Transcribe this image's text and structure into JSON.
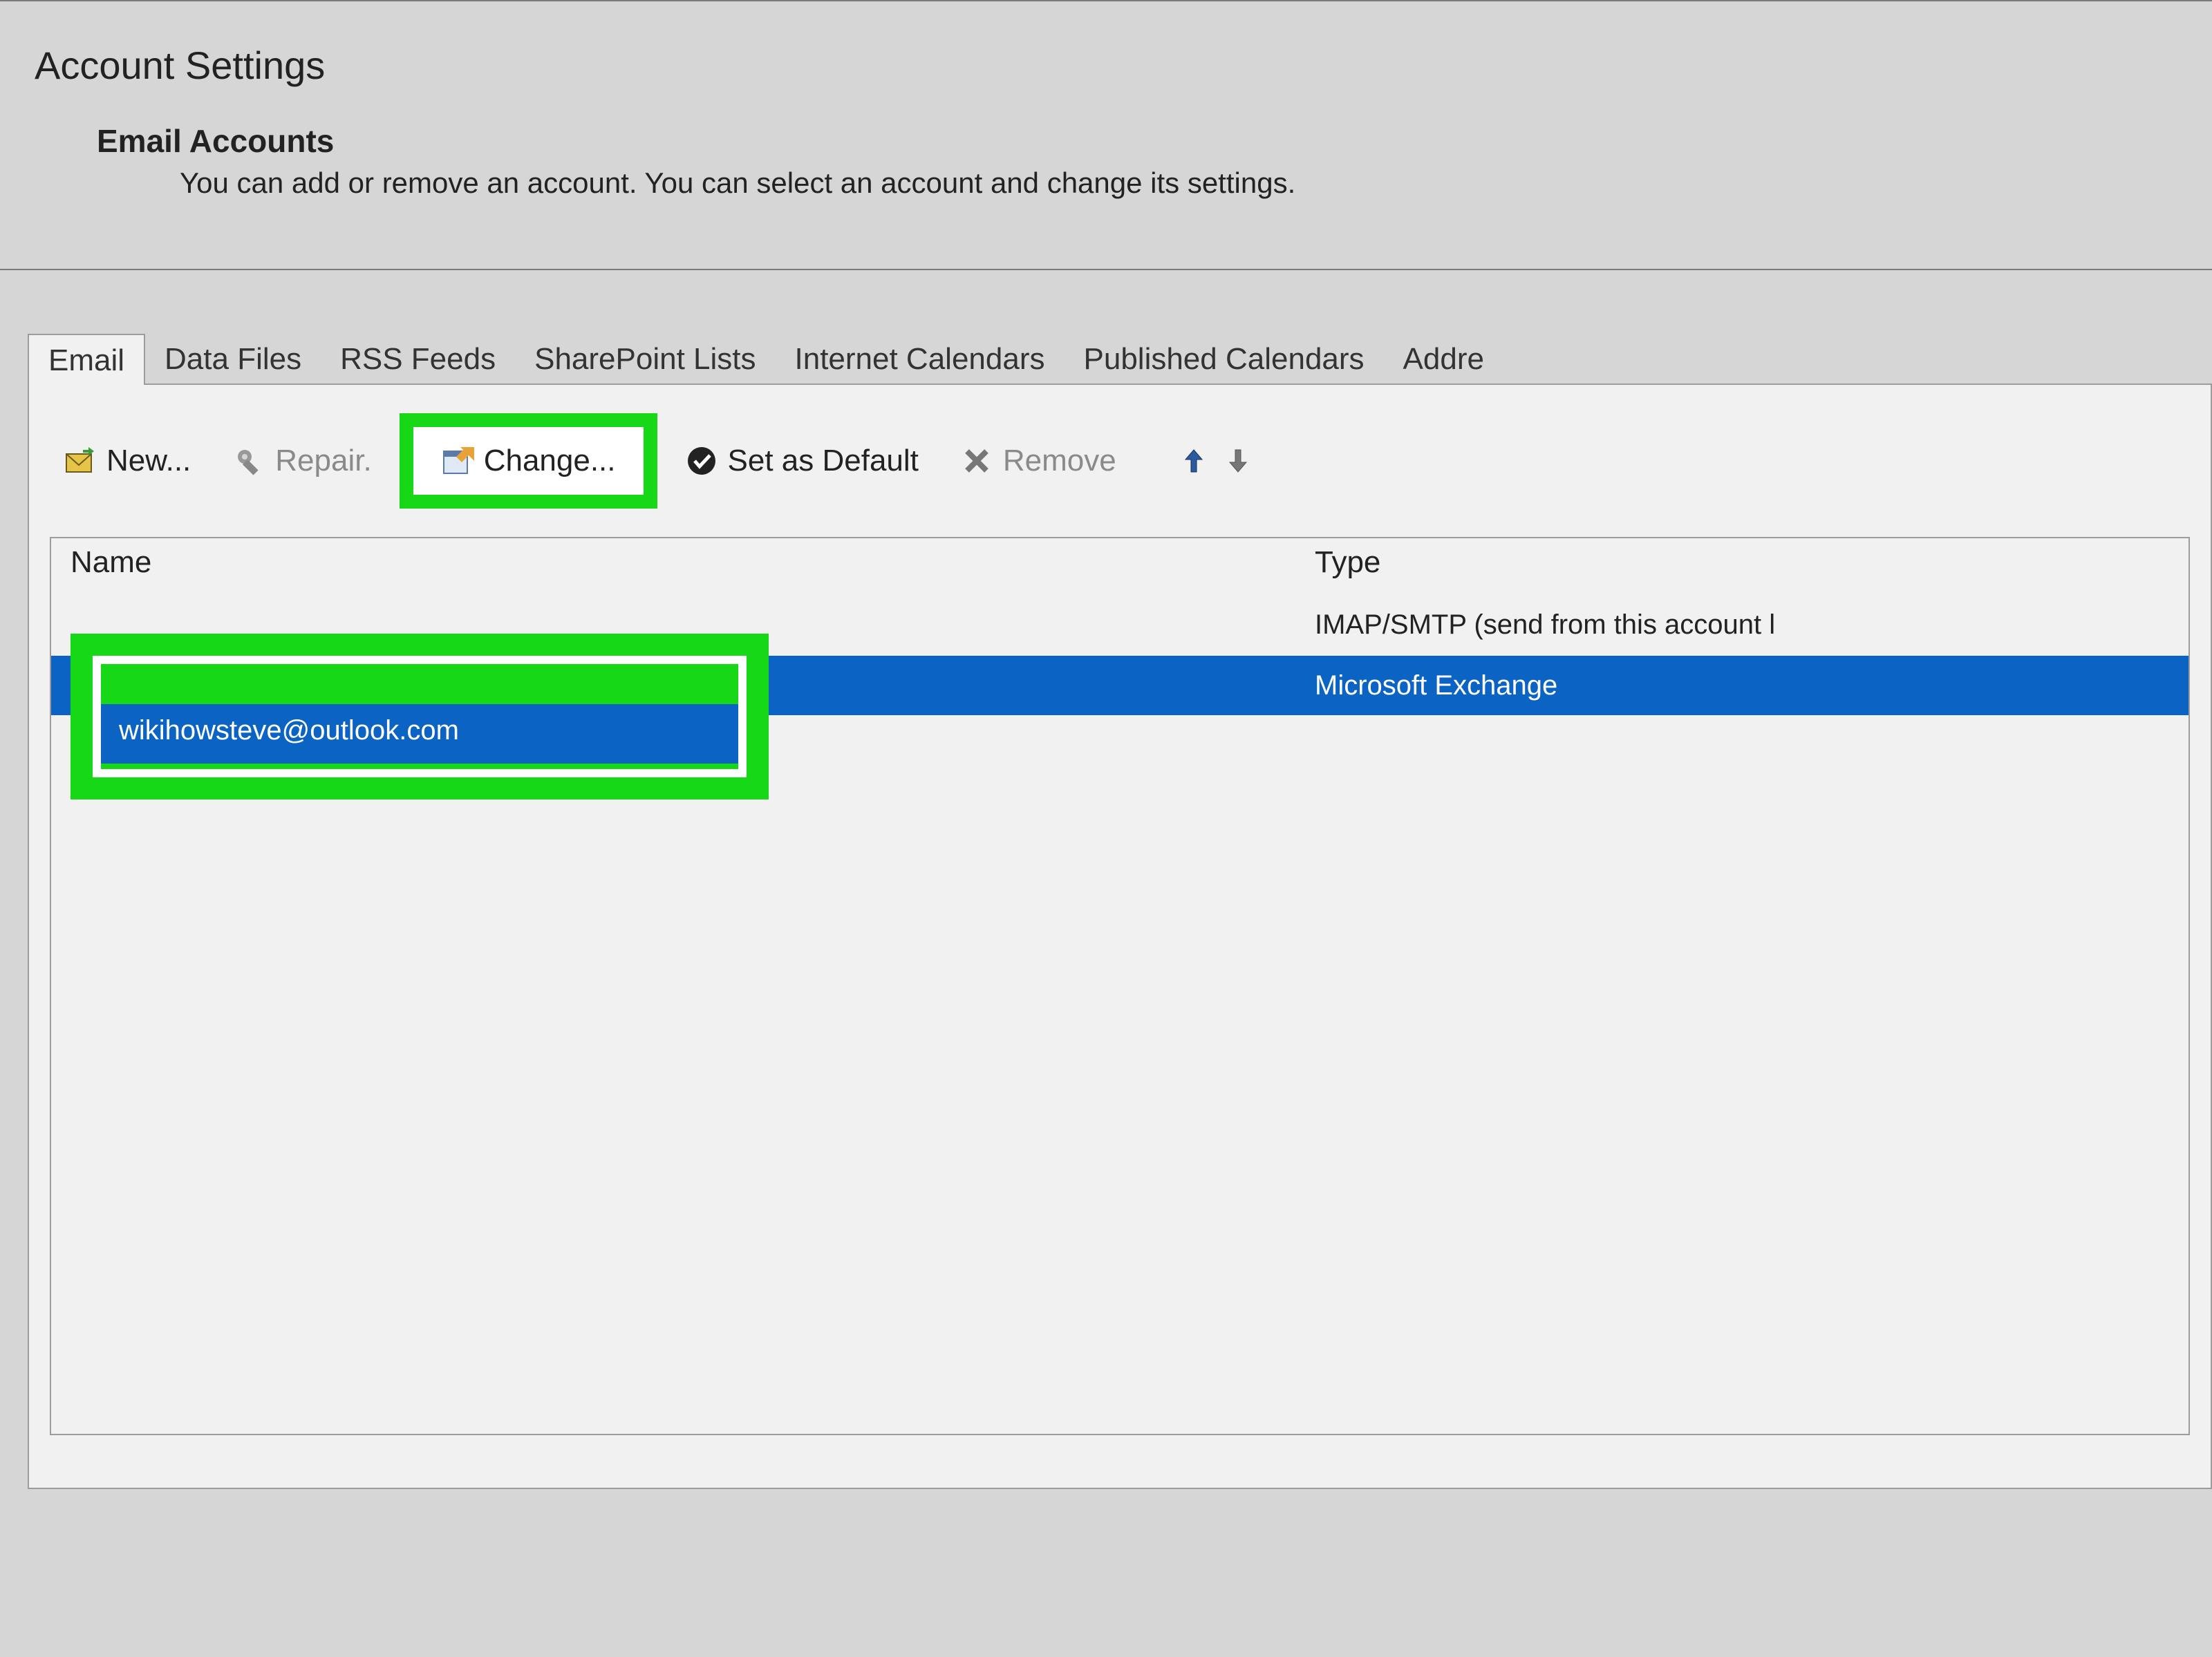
{
  "dialog": {
    "title": "Account Settings",
    "subtitle": "Email Accounts",
    "description": "You can add or remove an account. You can select an account and change its settings."
  },
  "tabs": [
    {
      "label": "Email",
      "active": true
    },
    {
      "label": "Data Files",
      "active": false
    },
    {
      "label": "RSS Feeds",
      "active": false
    },
    {
      "label": "SharePoint Lists",
      "active": false
    },
    {
      "label": "Internet Calendars",
      "active": false
    },
    {
      "label": "Published Calendars",
      "active": false
    },
    {
      "label": "Addre",
      "active": false
    }
  ],
  "toolbar": {
    "new": "New...",
    "repair": "Repair.",
    "change": "Change...",
    "default": "Set as Default",
    "remove": "Remove"
  },
  "columns": {
    "name": "Name",
    "type": "Type"
  },
  "accounts": [
    {
      "name": "",
      "type": "IMAP/SMTP (send from this account l",
      "selected": false
    },
    {
      "name": "wikihowsteve@outlook.com",
      "type": "Microsoft Exchange",
      "selected": true
    }
  ],
  "highlights": {
    "change_button": true,
    "selected_account_name": true
  }
}
